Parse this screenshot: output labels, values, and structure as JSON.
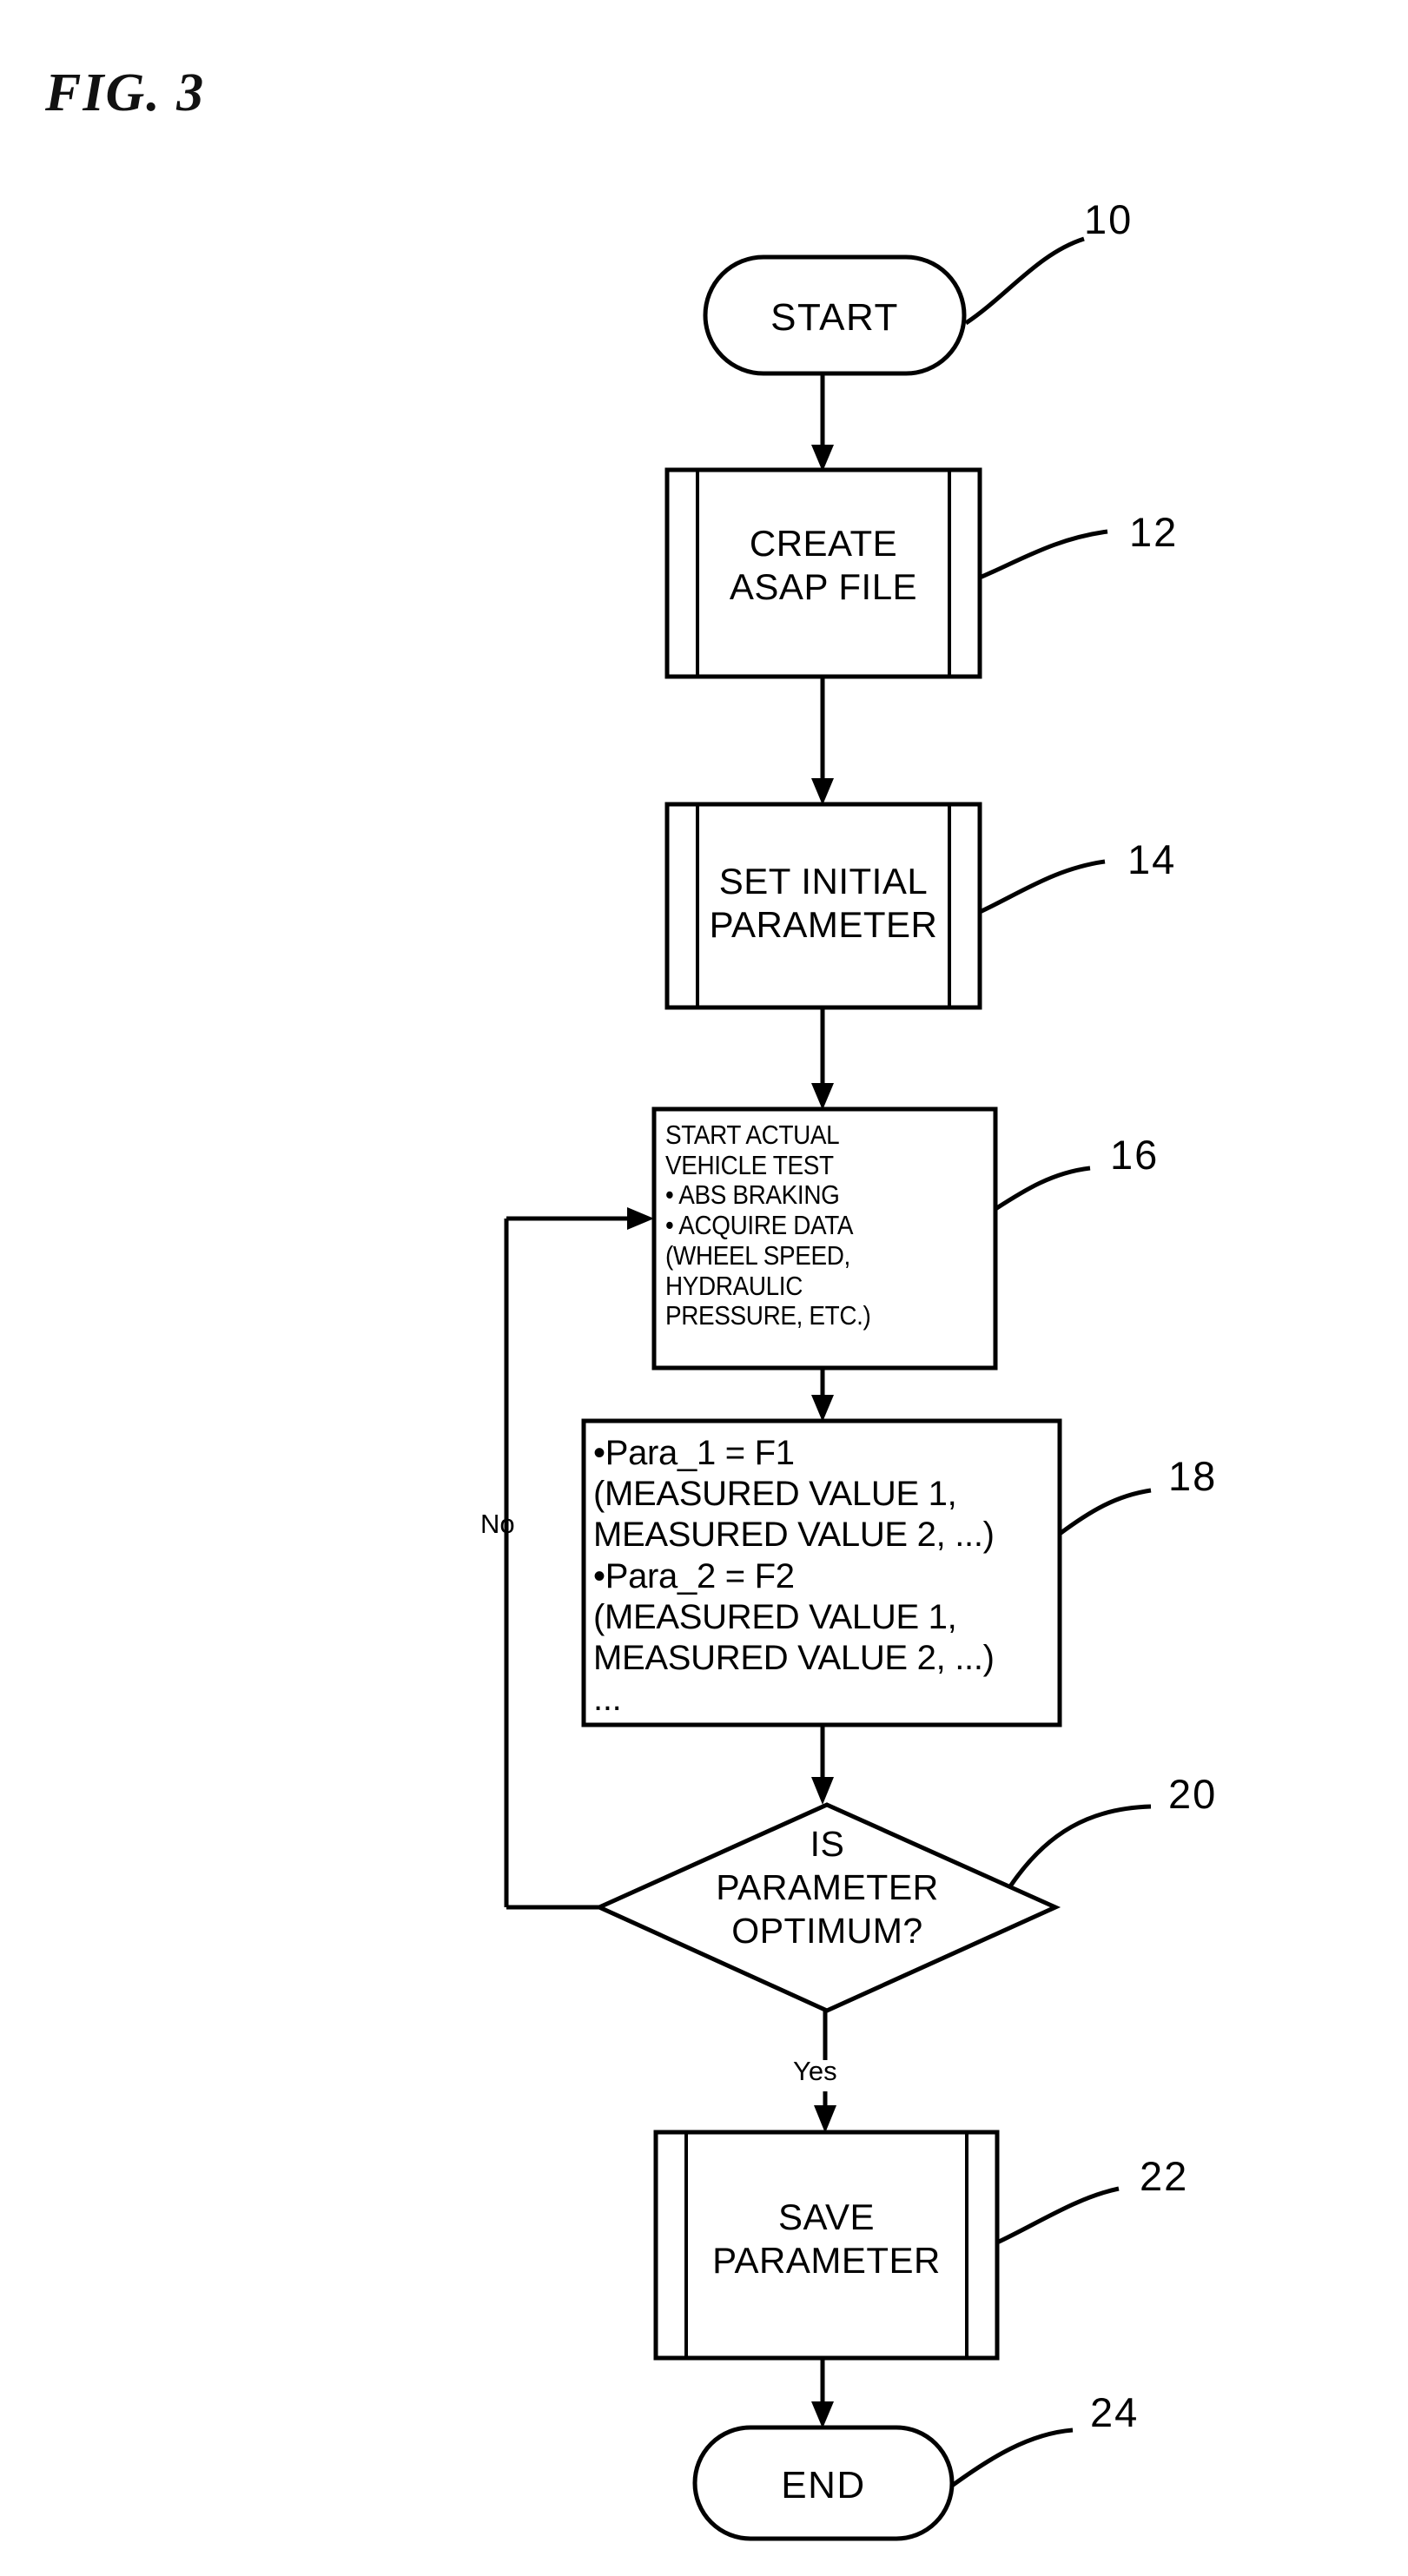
{
  "figure": {
    "title": "FIG. 3",
    "type": "flowchart",
    "description": "Patent flowchart for ABS parameter optimization using actual vehicle test"
  },
  "nodes": [
    {
      "id": "start",
      "shape": "terminal",
      "label": "START",
      "ref": "10"
    },
    {
      "id": "create-asap-file",
      "shape": "predefined-process",
      "label": "CREATE\nASAP FILE",
      "ref": "12"
    },
    {
      "id": "set-initial-parameter",
      "shape": "predefined-process",
      "label": "SET INITIAL\nPARAMETER",
      "ref": "14"
    },
    {
      "id": "start-actual-vehicle-test",
      "shape": "process",
      "label": "START ACTUAL\nVEHICLE TEST\n  • ABS BRAKING\n  • ACQUIRE DATA\n(WHEEL SPEED,\nHYDRAULIC\nPRESSURE, ETC.)",
      "ref": "16"
    },
    {
      "id": "parameter-computation",
      "shape": "process",
      "label": "•Para_1 = F1\n (MEASURED VALUE 1,\n MEASURED VALUE 2, ...)\n•Para_2 = F2\n (MEASURED VALUE 1,\n MEASURED VALUE 2, ...)\n               ...",
      "ref": "18"
    },
    {
      "id": "is-parameter-optimum",
      "shape": "decision",
      "label": "IS\nPARAMETER\nOPTIMUM?",
      "ref": "20"
    },
    {
      "id": "save-parameter",
      "shape": "predefined-process",
      "label": "SAVE\nPARAMETER",
      "ref": "22"
    },
    {
      "id": "end",
      "shape": "terminal",
      "label": "END",
      "ref": "24"
    }
  ],
  "edge_labels": {
    "no": "No",
    "yes": "Yes"
  },
  "colors": {
    "stroke": "#000000",
    "fill": "#ffffff",
    "background": "#ffffff"
  }
}
